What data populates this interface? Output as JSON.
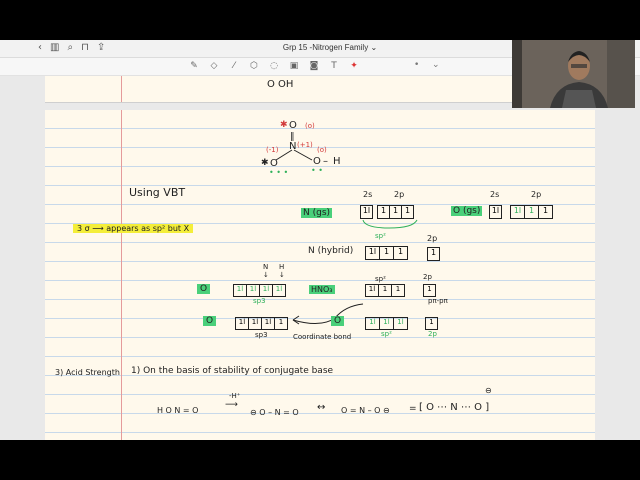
{
  "app": {
    "title": "Grp 15 -Nitrogen Family",
    "title_dropdown": "⌄",
    "nav_icons": [
      "chevron-left-icon",
      "sidebar-icon",
      "search-icon",
      "bookmark-icon",
      "share-icon"
    ],
    "tool_icons": [
      "pen-icon",
      "eraser-icon",
      "highlighter-icon",
      "shapes-icon",
      "lasso-icon",
      "image-icon",
      "camera-icon",
      "text-icon",
      "laser-icon"
    ],
    "tool_right": [
      "•",
      "⌄"
    ]
  },
  "notes": {
    "top_fragment": "O      OH",
    "structure": {
      "o_top": "O",
      "o_top_mark": "(o)",
      "n_label": "N",
      "n_charge": "(+1)",
      "o_left_charge": "(-1)",
      "o_left": "O",
      "o_right": "O",
      "o_right_mark": "(o)",
      "h": "H"
    },
    "using_vbt": "Using VBT",
    "sigma_note": "3 σ ⟶ appears as sp² but X",
    "n_gs": "N (gs)",
    "n_gs_2s_label": "2s",
    "n_gs_2p_label": "2p",
    "n_gs_2s": "1l",
    "n_gs_2p": [
      "1",
      "1",
      "1"
    ],
    "o_gs": "O (gs)",
    "o_gs_2s_label": "2s",
    "o_gs_2p_label": "2p",
    "o_gs_2s": "1l",
    "o_gs_2p": [
      "1l",
      "1",
      "1"
    ],
    "sp2_label": "sp²",
    "n_hybrid": "N (hybrid)",
    "n_hybrid_boxes": [
      "1l",
      "1",
      "1"
    ],
    "n_hybrid_2p_label": "2p",
    "n_hybrid_2p": "1",
    "o_left_row": "O",
    "o_left_boxes": [
      "1l",
      "1l",
      "1l",
      "1l"
    ],
    "o_left_sp3": "sp3",
    "arrows_n": "N",
    "arrows_h": "H",
    "hno3": "HNO₃",
    "hno3_boxes": [
      "1l",
      "1",
      "1"
    ],
    "hno3_sp2": "sp²",
    "hno3_2p_label": "2p",
    "hno3_2p": "1",
    "p_pi": "pπ-pπ",
    "o_bottom_left": "O",
    "o_bottom_left_boxes": [
      "1l",
      "1l",
      "1l",
      "1"
    ],
    "o_bottom_left_sp3": "sp3",
    "coordinate_bond": "Coordinate bond",
    "o_bottom_right": "O",
    "o_bottom_right_boxes": [
      "1l",
      "1l",
      "1l"
    ],
    "o_bottom_right_sp2": "sp²",
    "o_bottom_right_2p": "1",
    "o_bottom_right_2p_label": "2p",
    "acid_strength": "3) Acid Strength",
    "on_basis": "1) On the basis of stability of conjugate base",
    "reaction_left": "H O N = O",
    "minus_h": "-H⁺",
    "conj_base_1": "⊖ O – N = O",
    "double_arrow": "↔",
    "conj_base_2": "O = N – O ⊖",
    "equals": "=",
    "resonance_hybrid": "[ O ⋯ N ⋯ O ]",
    "hybrid_charge": "⊖"
  },
  "colors": {
    "page": "#fff9ec",
    "rule": "#c8d9ea",
    "margin": "#e59b9b",
    "ink": "#222222",
    "red_ink": "#d23a3a",
    "green_ink": "#2fb05a",
    "highlight_green": "#4ad07a",
    "highlight_yellow": "#f4ee3a"
  }
}
